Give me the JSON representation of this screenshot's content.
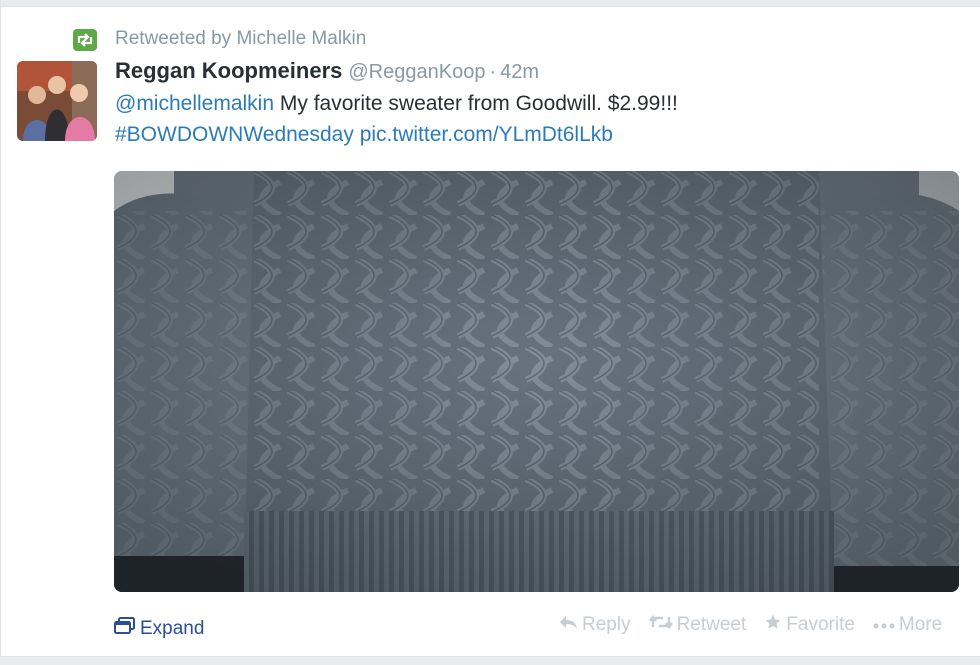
{
  "retweet": {
    "label": "Retweeted by Michelle Malkin"
  },
  "tweet": {
    "name": "Reggan Koopmeiners",
    "handle": "@RegganKoop",
    "separator": "·",
    "time": "42m",
    "mention": "@michellemalkin",
    "text": "My favorite sweater from Goodwill. $2.99!!!",
    "hashtag": "#BOWDOWNWednesday",
    "pic_link": "pic.twitter.com/YLmDt6lLkb"
  },
  "actions": {
    "expand": "Expand",
    "reply": "Reply",
    "retweet": "Retweet",
    "favorite": "Favorite",
    "more": "More"
  },
  "colors": {
    "link": "#2b7bb9",
    "retweet_green": "#5ea84a",
    "muted": "#8899a6",
    "action_muted": "#c6cdd3"
  },
  "icons": [
    "retweet-icon",
    "expand-icon",
    "reply-icon",
    "favorite-star-icon",
    "more-dots-icon"
  ]
}
